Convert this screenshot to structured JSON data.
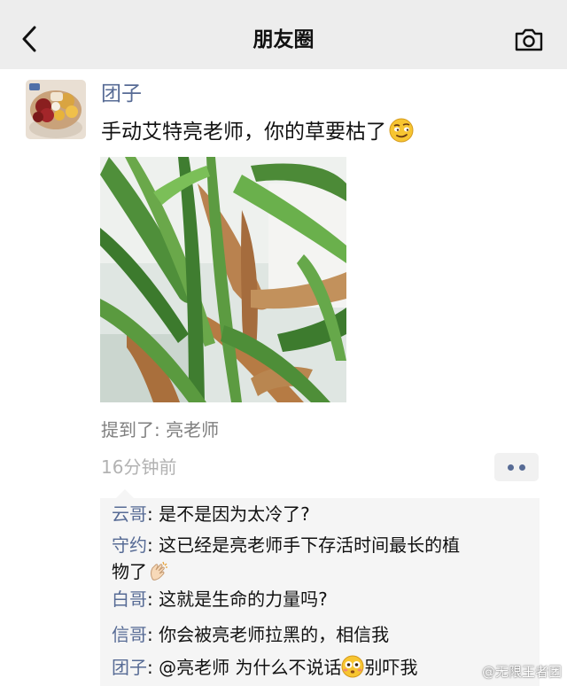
{
  "navbar": {
    "title": "朋友圈",
    "back_icon": "chevron-left-icon",
    "camera_icon": "camera-icon"
  },
  "post": {
    "author": "团子",
    "text": "手动艾特亮老师，你的草要枯了",
    "text_emoji": "smirk-face-emoji",
    "mentioned": "提到了: 亮老师",
    "timestamp": "16分钟前"
  },
  "comments": [
    {
      "name": "云哥",
      "sep": ": ",
      "text": "是不是因为太冷了?"
    },
    {
      "name": "守约",
      "sep": ": ",
      "text": "这已经是亮老师手下存活时间最长的植",
      "text2": "物了"
    },
    {
      "name": "白哥",
      "sep": ": ",
      "text": "这就是生命的力量吗?"
    },
    {
      "name": "信哥",
      "sep": ": ",
      "text": "你会被亮老师拉黑的，相信我"
    },
    {
      "name": "团子",
      "sep": ": ",
      "text": "@亮老师 为什么不说话",
      "text2": "别吓我"
    }
  ],
  "watermark": "@无限王者团",
  "colors": {
    "name_blue": "#576b95",
    "navbar_bg": "#ededed",
    "comment_bg": "#f5f5f5"
  }
}
